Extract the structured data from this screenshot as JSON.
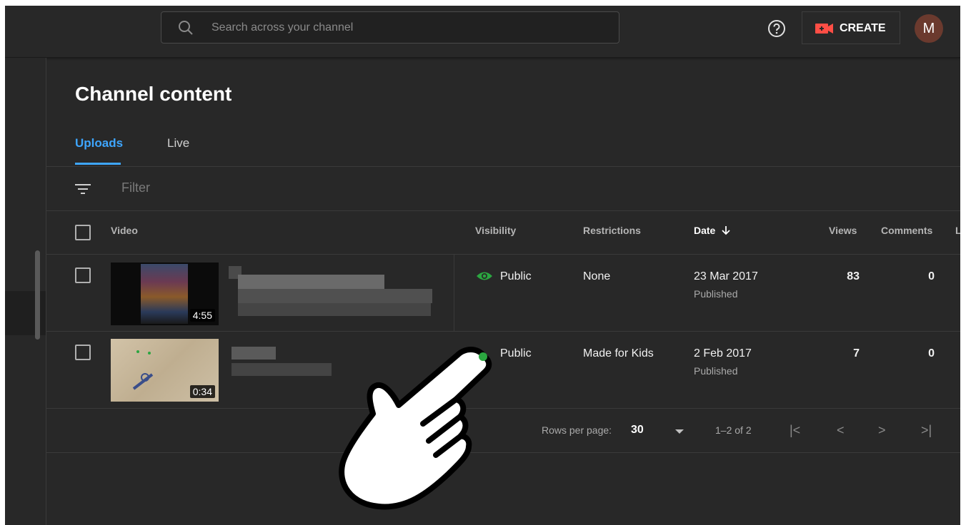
{
  "topbar": {
    "search_placeholder": "Search across your channel",
    "create_label": "CREATE",
    "avatar_letter": "M"
  },
  "main": {
    "title": "Channel content",
    "tabs": [
      {
        "label": "Uploads",
        "active": true
      },
      {
        "label": "Live",
        "active": false
      }
    ],
    "filter_placeholder": "Filter"
  },
  "table": {
    "headers": {
      "video": "Video",
      "visibility": "Visibility",
      "restrictions": "Restrictions",
      "date": "Date",
      "views": "Views",
      "comments": "Comments"
    },
    "rows": [
      {
        "duration": "4:55",
        "visibility": "Public",
        "restrictions": "None",
        "date": "23 Mar 2017",
        "status": "Published",
        "views": "83",
        "comments": "0"
      },
      {
        "duration": "0:34",
        "visibility": "Public",
        "restrictions": "Made for Kids",
        "date": "2 Feb 2017",
        "status": "Published",
        "views": "7",
        "comments": "0"
      }
    ]
  },
  "pagination": {
    "rows_per_page_label": "Rows per page:",
    "rows_per_page": "30",
    "range": "1–2 of 2"
  },
  "colors": {
    "accent": "#3ea6ff",
    "public": "#2ba640",
    "create_icon": "#ff4e45"
  }
}
